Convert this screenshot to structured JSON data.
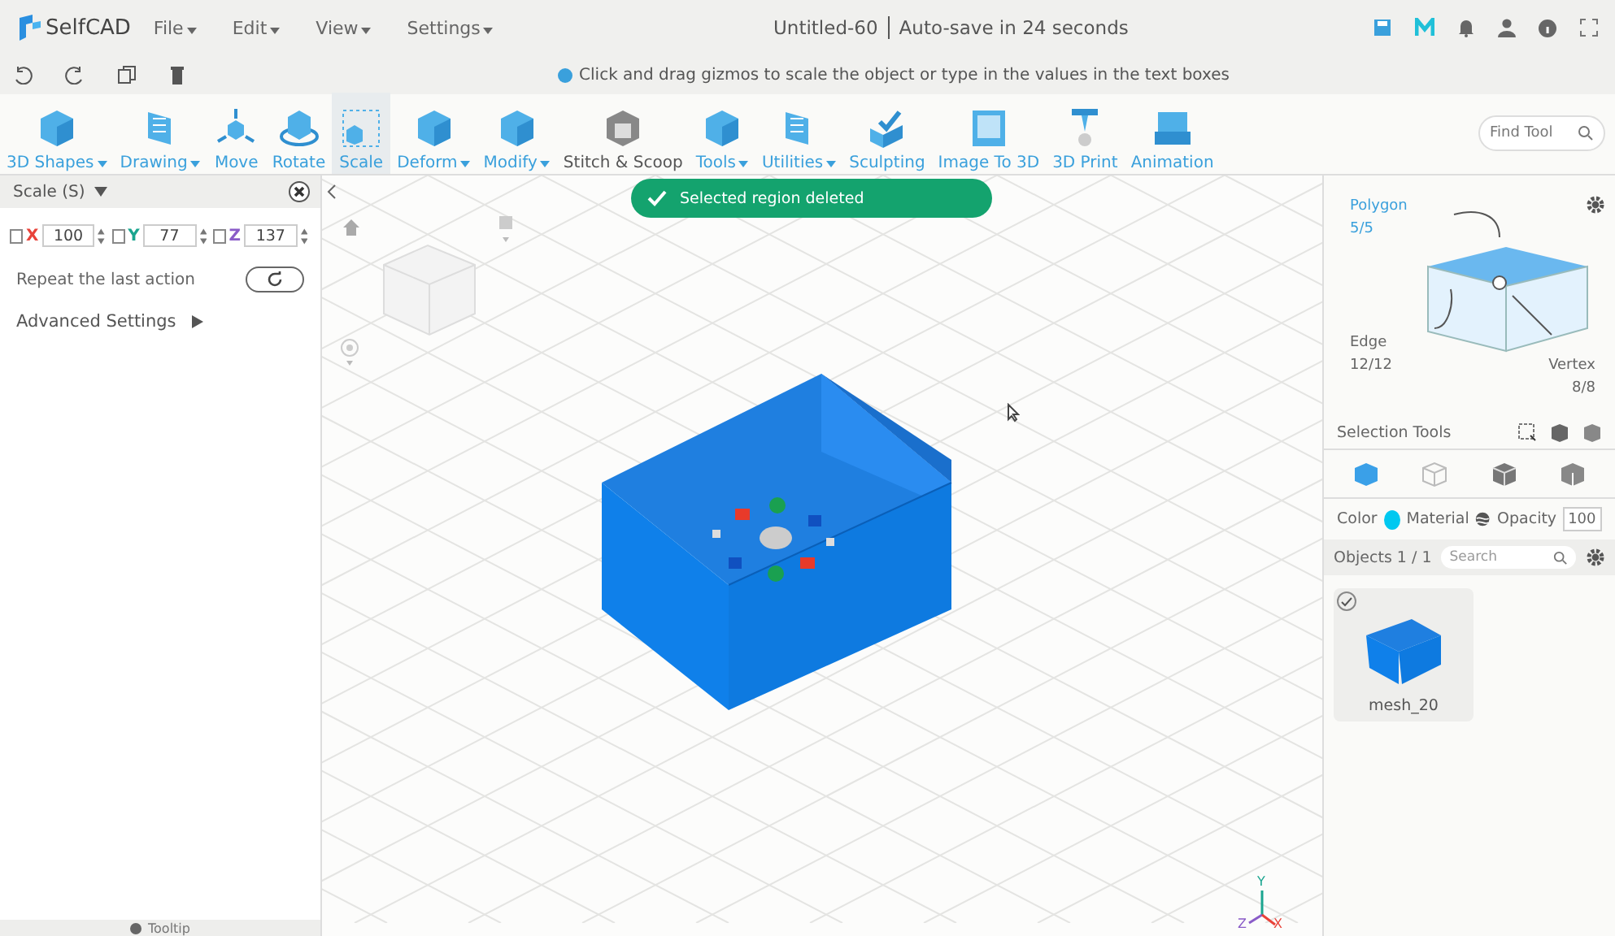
{
  "app": {
    "logo": "SelfCAD",
    "menus": [
      "File",
      "Edit",
      "View",
      "Settings"
    ],
    "doc_title": "Untitled-60",
    "autosave": "Auto-save in 24 seconds"
  },
  "hint": "Click and drag gizmos to scale the object or type in the values in the text boxes",
  "toolbar": [
    {
      "label": "3D Shapes",
      "dropdown": true,
      "selected": false,
      "kind": "cube"
    },
    {
      "label": "Drawing",
      "dropdown": true,
      "selected": false,
      "kind": "sheet"
    },
    {
      "label": "Move",
      "dropdown": false,
      "selected": false,
      "kind": "move"
    },
    {
      "label": "Rotate",
      "dropdown": false,
      "selected": false,
      "kind": "rotate"
    },
    {
      "label": "Scale",
      "dropdown": false,
      "selected": true,
      "kind": "scale"
    },
    {
      "label": "Deform",
      "dropdown": true,
      "selected": false,
      "kind": "cube"
    },
    {
      "label": "Modify",
      "dropdown": true,
      "selected": false,
      "kind": "cube"
    },
    {
      "label": "Stitch & Scoop",
      "dropdown": false,
      "selected": false,
      "kind": "stitch"
    },
    {
      "label": "Tools",
      "dropdown": true,
      "selected": false,
      "kind": "cube"
    },
    {
      "label": "Utilities",
      "dropdown": true,
      "selected": false,
      "kind": "sheet"
    },
    {
      "label": "Sculpting",
      "dropdown": false,
      "selected": false,
      "kind": "sculpt"
    },
    {
      "label": "Image To 3D",
      "dropdown": false,
      "selected": false,
      "kind": "image"
    },
    {
      "label": "3D Print",
      "dropdown": false,
      "selected": false,
      "kind": "print"
    },
    {
      "label": "Animation",
      "dropdown": false,
      "selected": false,
      "kind": "anim"
    }
  ],
  "find_tool": {
    "placeholder": "Find Tool"
  },
  "toast": "Selected region deleted",
  "scale_panel": {
    "title": "Scale (S)",
    "axes": [
      {
        "label": "X",
        "value": "100",
        "checked": false,
        "color": "#e8433a"
      },
      {
        "label": "Y",
        "value": "77",
        "checked": false,
        "color": "#1aa58f"
      },
      {
        "label": "Z",
        "value": "137",
        "checked": false,
        "color": "#8a5cc8"
      }
    ],
    "repeat": "Repeat the last action",
    "advanced": "Advanced Settings",
    "tooltip": "Tooltip"
  },
  "selection_modes": {
    "polygon": {
      "label": "Polygon",
      "count": "5/5",
      "selected": true
    },
    "edge": {
      "label": "Edge",
      "count": "12/12",
      "selected": false
    },
    "vertex": {
      "label": "Vertex",
      "count": "8/8",
      "selected": false
    }
  },
  "selection_tools": "Selection Tools",
  "properties": {
    "color_label": "Color",
    "color": "#00c8f0",
    "material": "Material",
    "opacity_label": "Opacity",
    "opacity": "100"
  },
  "objects": {
    "title": "Objects 1 / 1",
    "search_placeholder": "Search",
    "items": [
      {
        "name": "mesh_20",
        "checked": true
      }
    ]
  },
  "axes": [
    "Y",
    "Z",
    "X"
  ]
}
